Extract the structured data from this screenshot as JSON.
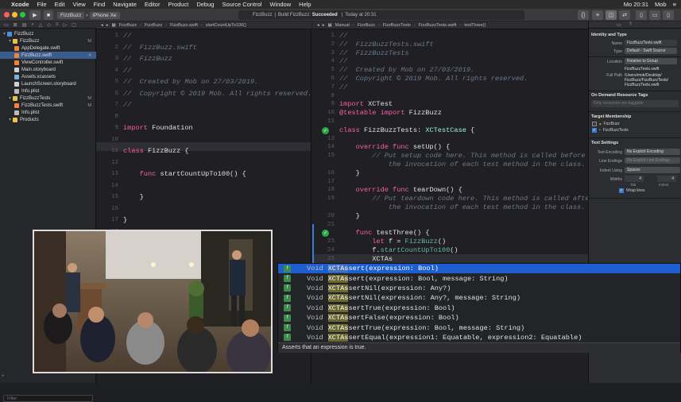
{
  "menubar": {
    "app": "Xcode",
    "items": [
      "File",
      "Edit",
      "View",
      "Find",
      "Navigate",
      "Editor",
      "Product",
      "Debug",
      "Source Control",
      "Window",
      "Help"
    ],
    "time": "Mo 20:31",
    "user": "Mob"
  },
  "toolbar": {
    "scheme": "FizzBuzz",
    "device": "iPhone Xe",
    "status_project": "FizzBuzz",
    "status_text": "Build FizzBuzz:",
    "status_result": "Succeeded",
    "status_time": "Today at 20:31"
  },
  "navigator": {
    "rows": [
      {
        "label": "FizzBuzz",
        "indent": 0,
        "type": "project",
        "badge": ""
      },
      {
        "label": "FizzBuzz",
        "indent": 1,
        "type": "folder",
        "badge": "M"
      },
      {
        "label": "AppDelegate.swift",
        "indent": 2,
        "type": "swift",
        "badge": ""
      },
      {
        "label": "FizzBuzz.swift",
        "indent": 2,
        "type": "swift",
        "badge": "A",
        "selected": true
      },
      {
        "label": "ViewController.swift",
        "indent": 2,
        "type": "swift",
        "badge": ""
      },
      {
        "label": "Main.storyboard",
        "indent": 2,
        "type": "storyboard",
        "badge": ""
      },
      {
        "label": "Assets.xcassets",
        "indent": 2,
        "type": "assets",
        "badge": ""
      },
      {
        "label": "LaunchScreen.storyboard",
        "indent": 2,
        "type": "storyboard",
        "badge": ""
      },
      {
        "label": "Info.plist",
        "indent": 2,
        "type": "plist",
        "badge": ""
      },
      {
        "label": "FizzBuzzTests",
        "indent": 1,
        "type": "folder",
        "badge": "M"
      },
      {
        "label": "FizzBuzzTests.swift",
        "indent": 2,
        "type": "swift",
        "badge": "M"
      },
      {
        "label": "Info.plist",
        "indent": 2,
        "type": "plist",
        "badge": ""
      },
      {
        "label": "Products",
        "indent": 1,
        "type": "folder",
        "badge": ""
      }
    ],
    "filter_placeholder": "Filter"
  },
  "left_editor": {
    "jumpbar": [
      "FizzBuzz",
      "FizzBuzz",
      "FizzBuzz.swift",
      "startCountUpTo100()"
    ],
    "lines": [
      {
        "n": "1",
        "html": "<span class='cmt'>//</span>"
      },
      {
        "n": "2",
        "html": "<span class='cmt'>//  FizzBuzz.swift</span>"
      },
      {
        "n": "3",
        "html": "<span class='cmt'>//  FizzBuzz</span>"
      },
      {
        "n": "4",
        "html": "<span class='cmt'>//</span>"
      },
      {
        "n": "5",
        "html": "<span class='cmt'>//  Created by Mob on 27/03/2019.</span>"
      },
      {
        "n": "6",
        "html": "<span class='cmt'>//  Copyright © 2019 Mob. All rights reserved.</span>"
      },
      {
        "n": "7",
        "html": "<span class='cmt'>//</span>"
      },
      {
        "n": "8",
        "html": ""
      },
      {
        "n": "9",
        "html": "<span class='kw'>import</span> Foundation"
      },
      {
        "n": "10",
        "html": ""
      },
      {
        "n": "11",
        "html": "<span class='kw'>class</span> FizzBuzz {"
      },
      {
        "n": "12",
        "html": ""
      },
      {
        "n": "13",
        "html": "    <span class='kw'>func</span> startCountUpTo100() {"
      },
      {
        "n": "14",
        "html": "        "
      },
      {
        "n": "15",
        "html": "    }"
      },
      {
        "n": "16",
        "html": ""
      },
      {
        "n": "17",
        "html": "}"
      },
      {
        "n": "18",
        "html": ""
      }
    ]
  },
  "right_editor": {
    "jumpbar": [
      "Manual",
      "FizzBuzz",
      "FizzBuzzTests",
      "FizzBuzzTests.swift",
      "testThree()"
    ],
    "lines": [
      {
        "n": "1",
        "html": "<span class='cmt'>//</span>"
      },
      {
        "n": "2",
        "html": "<span class='cmt'>//  FizzBuzzTests.swift</span>"
      },
      {
        "n": "3",
        "html": "<span class='cmt'>//  FizzBuzzTests</span>"
      },
      {
        "n": "4",
        "html": "<span class='cmt'>//</span>"
      },
      {
        "n": "5",
        "html": "<span class='cmt'>//  Created by Mob on 27/03/2019.</span>"
      },
      {
        "n": "6",
        "html": "<span class='cmt'>//  Copyright © 2019 Mob. All rights reserved.</span>"
      },
      {
        "n": "7",
        "html": "<span class='cmt'>//</span>"
      },
      {
        "n": "8",
        "html": ""
      },
      {
        "n": "9",
        "html": "<span class='kw'>import</span> XCTest"
      },
      {
        "n": "10",
        "html": "<span class='kw'>@testable import</span> FizzBuzz"
      },
      {
        "n": "11",
        "html": ""
      },
      {
        "n": "12",
        "html": "<span class='kw'>class</span> FizzBuzzTests: <span class='ty'>XCTestCase</span> {"
      },
      {
        "n": "13",
        "html": ""
      },
      {
        "n": "14",
        "html": "    <span class='kw'>override func</span> setUp() {"
      },
      {
        "n": "15",
        "html": "        <span class='cmt'>// Put setup code here. This method is called before</span>"
      },
      {
        "n": "",
        "html": "            <span class='cmt'>the invocation of each test method in the class.</span>"
      },
      {
        "n": "16",
        "html": "    }"
      },
      {
        "n": "17",
        "html": ""
      },
      {
        "n": "18",
        "html": "    <span class='kw'>override func</span> tearDown() {"
      },
      {
        "n": "19",
        "html": "        <span class='cmt'>// Put teardown code here. This method is called after</span>"
      },
      {
        "n": "",
        "html": "            <span class='cmt'>the invocation of each test method in the class.</span>"
      },
      {
        "n": "20",
        "html": "    }"
      },
      {
        "n": "21",
        "html": ""
      },
      {
        "n": "22",
        "html": "    <span class='kw'>func</span> testThree() {"
      },
      {
        "n": "23",
        "html": "        <span class='kw'>let</span> f = <span class='fn'>FizzBuzz</span>()"
      },
      {
        "n": "24",
        "html": "        f.<span class='fn'>startCountUpTo100</span>()"
      },
      {
        "n": "25",
        "html": "        XCTAs"
      }
    ]
  },
  "completion": {
    "items": [
      {
        "ret": "Void",
        "hl": "XCTAs",
        "rest": "sert(expression: Bool)"
      },
      {
        "ret": "Void",
        "hl": "XCTAs",
        "rest": "sert(expression: Bool, message: String)"
      },
      {
        "ret": "Void",
        "hl": "XCTAs",
        "rest": "sertNil(expression: Any?)"
      },
      {
        "ret": "Void",
        "hl": "XCTAs",
        "rest": "sertNil(expression: Any?, message: String)"
      },
      {
        "ret": "Void",
        "hl": "XCTAs",
        "rest": "sertTrue(expression: Bool)"
      },
      {
        "ret": "Void",
        "hl": "XCTAs",
        "rest": "sertFalse(expression: Bool)"
      },
      {
        "ret": "Void",
        "hl": "XCTAs",
        "rest": "sertTrue(expression: Bool, message: String)"
      },
      {
        "ret": "Void",
        "hl": "XCTAs",
        "rest": "sertEqual(expression1: Equatable, expression2: Equatable)"
      }
    ],
    "doc": "Asserts that an expression is true."
  },
  "inspector": {
    "identity_header": "Identity and Type",
    "name_label": "Name",
    "name_value": "FizzBuzzTests.swift",
    "type_label": "Type",
    "type_value": "Default - Swift Source",
    "location_label": "Location",
    "location_value": "Relative to Group",
    "location_file": "FizzBuzzTests.swift",
    "fullpath_label": "Full Path",
    "fullpath_value": [
      "/Users/mob/Desktop/",
      "FizzBuzz/FizzBuzzTests/",
      "FizzBuzzTests.swift"
    ],
    "ondemand_header": "On Demand Resource Tags",
    "ondemand_placeholder": "Only resources are taggable",
    "membership_header": "Target Membership",
    "targets": [
      "FizzBuzz",
      "FizzBuzzTests"
    ],
    "textsettings_header": "Text Settings",
    "encoding_label": "Text Encoding",
    "encoding_value": "No Explicit Encoding",
    "lineendings_label": "Line Endings",
    "lineendings_value": "No Explicit Line Endings",
    "indent_label": "Indent Using",
    "indent_value": "Spaces",
    "widths_label": "Widths",
    "tab_width": "4",
    "indent_width": "4",
    "tab_caption": "Tab",
    "indent_caption": "Indent",
    "wrap_label": "Wrap lines"
  },
  "video": {
    "description_icon": "video-overlay"
  }
}
